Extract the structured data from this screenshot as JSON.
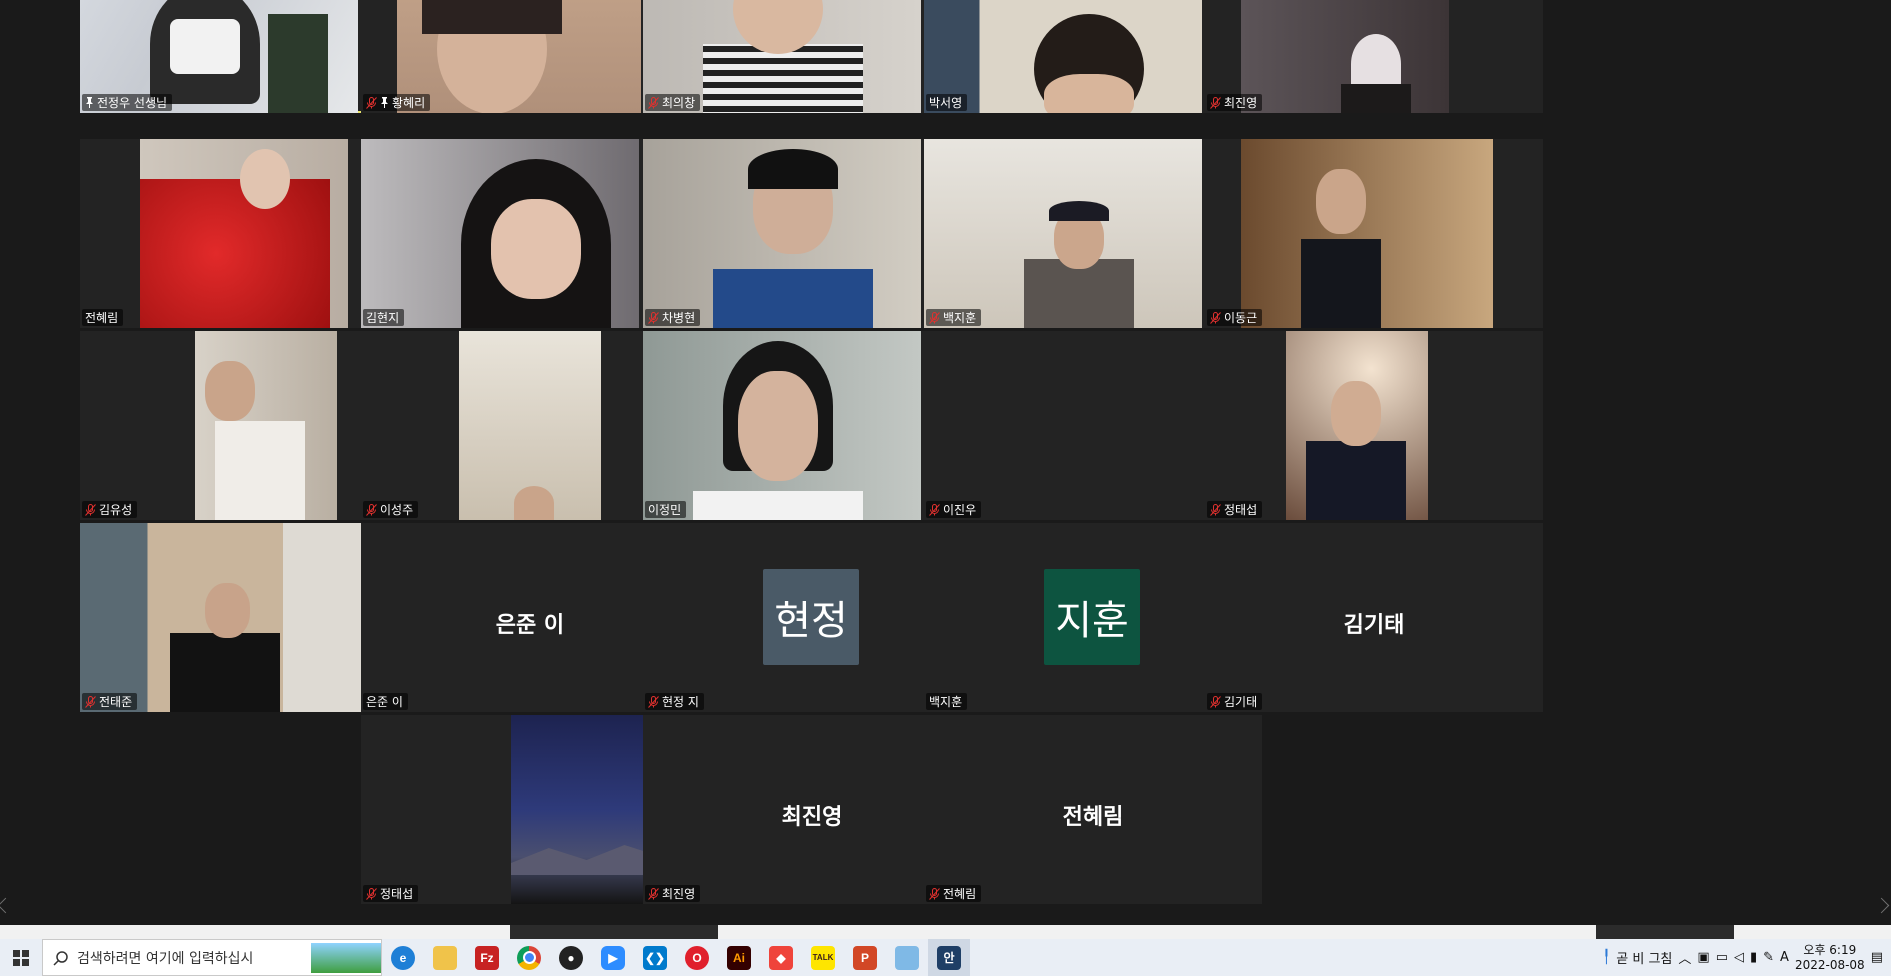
{
  "colors": {
    "stage_bg": "#1a1a1a",
    "tile_bg": "#232323",
    "active_border": "#e8e36a",
    "muted_mic": "#e0312f",
    "avatar_hyunjung": "#4a5a67",
    "avatar_jihoon": "#0d5440",
    "taskbar_bg": "#e9eef5"
  },
  "gallery": {
    "row1": [
      {
        "name": "전정우 선생님",
        "muted": false,
        "pinned": true,
        "active": true
      },
      {
        "name": "황혜리",
        "muted": true,
        "pinned": true
      },
      {
        "name": "최의창",
        "muted": true
      },
      {
        "name": "박서영",
        "muted": false
      },
      {
        "name": "최진영",
        "muted": true
      }
    ],
    "row2": [
      {
        "name": "전혜림",
        "muted": false
      },
      {
        "name": "김현지",
        "muted": false
      },
      {
        "name": "차병현",
        "muted": true
      },
      {
        "name": "백지훈",
        "muted": true
      },
      {
        "name": "이동근",
        "muted": true
      }
    ],
    "row3": [
      {
        "name": "김유성",
        "muted": true
      },
      {
        "name": "이성주",
        "muted": true
      },
      {
        "name": "이정민",
        "muted": false
      },
      {
        "name": "이진우",
        "muted": true
      },
      {
        "name": "정태섭",
        "muted": true
      }
    ],
    "row4": [
      {
        "name": "전태준",
        "muted": true
      },
      {
        "name": "은준 이",
        "display": "은준 이",
        "muted": false
      },
      {
        "name": "현정 지",
        "avatar": "현정",
        "muted": true
      },
      {
        "name": "백지훈",
        "avatar": "지훈",
        "muted": false
      },
      {
        "name": "김기태",
        "display": "김기태",
        "muted": true
      }
    ],
    "row5": [
      {
        "name": "정태섭",
        "muted": true
      },
      {
        "name": "최진영",
        "display": "최진영",
        "muted": true
      },
      {
        "name": "전혜림",
        "display": "전혜림",
        "muted": true
      }
    ]
  },
  "taskbar": {
    "search_placeholder": "검색하려면 여기에 입력하십시",
    "icons": [
      "edge-icon",
      "file-explorer-icon",
      "filezilla-icon",
      "chrome-icon",
      "maps-pin-icon",
      "zoom-icon",
      "vscode-icon",
      "opera-icon",
      "illustrator-icon",
      "anydesk-icon",
      "kakaotalk-icon",
      "powerpoint-icon",
      "notepad-icon",
      "app-icon"
    ],
    "illustrator_label": "Ai",
    "kakaotalk_label": "TALK",
    "powerpoint_label": "P",
    "active_app_label": "안",
    "weather_text": "곧 비 그침",
    "ime_indicator": "A",
    "time": "오후 6:19",
    "date": "2022-08-08"
  }
}
